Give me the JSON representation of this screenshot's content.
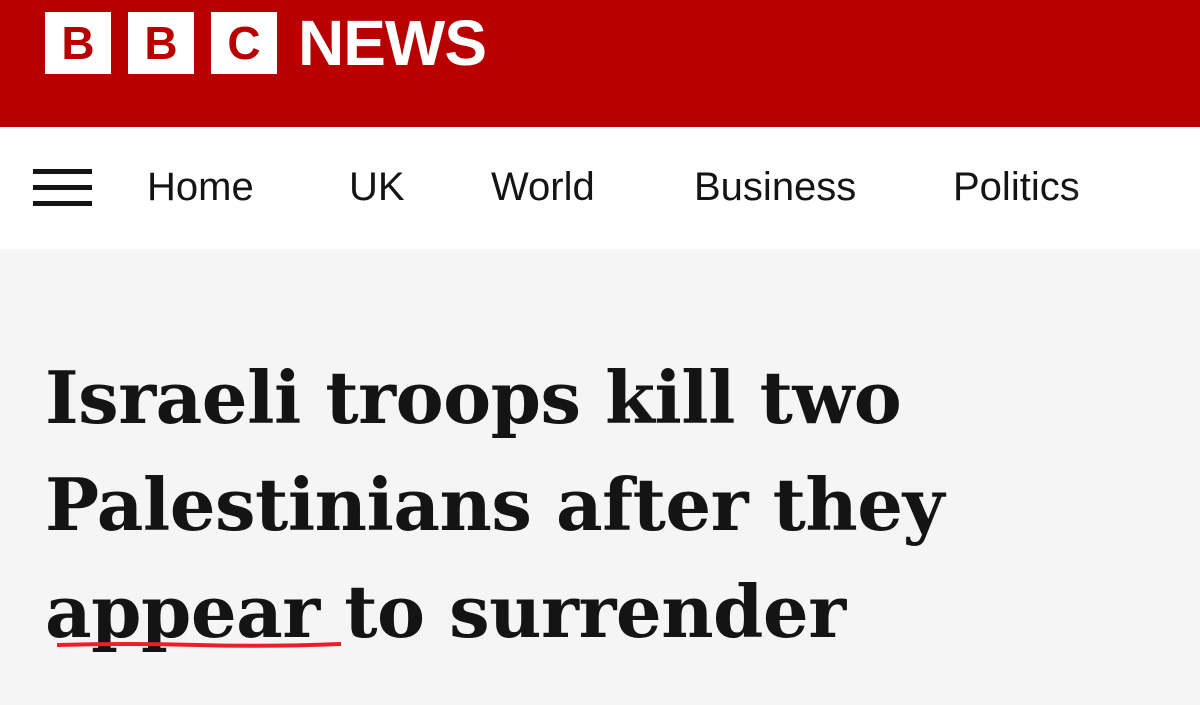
{
  "masthead": {
    "logo_letters": [
      "B",
      "B",
      "C"
    ],
    "logo_word": "NEWS",
    "brand_color": "#b80000"
  },
  "nav": {
    "menu_icon": "hamburger-menu-icon",
    "items": [
      {
        "label": "Home"
      },
      {
        "label": "UK"
      },
      {
        "label": "World"
      },
      {
        "label": "Business"
      },
      {
        "label": "Politics"
      }
    ]
  },
  "article": {
    "headline_lines": [
      "Israeli troops kill two",
      "Palestinians after they",
      "appear to surrender"
    ],
    "annotation_color": "#e8202a"
  }
}
